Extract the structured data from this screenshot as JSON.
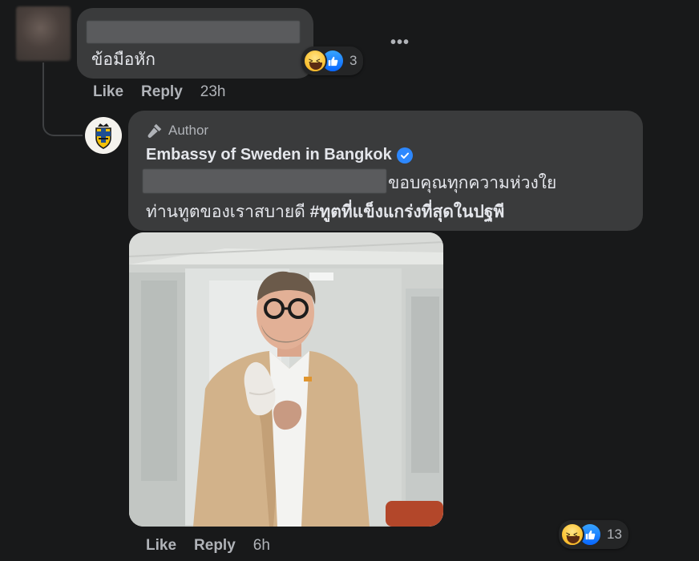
{
  "reply_comment": {
    "text": "ข้อมือหัก",
    "reaction_count": "3",
    "actions": {
      "like": "Like",
      "reply": "Reply",
      "time": "23h"
    },
    "more": "•••"
  },
  "author_reply": {
    "author_badge": "Author",
    "name": "Embassy of Sweden in Bangkok",
    "line1": "ขอบคุณทุกความห่วงใย",
    "line2_plain": "ท่านทูตของเราสบายดี ",
    "hashtag": "#ทูตที่แข็งแกร่งที่สุดในปฐพี",
    "reaction_count": "13",
    "actions": {
      "like": "Like",
      "reply": "Reply",
      "time": "6h"
    }
  },
  "icons": {
    "reactions": [
      "haha-reaction-icon",
      "like-reaction-icon"
    ],
    "author": "microphone-icon",
    "verified": "verified-badge-icon"
  },
  "colors": {
    "background": "#18191a",
    "bubble": "#3a3b3c",
    "text_primary": "#e4e6eb",
    "text_secondary": "#b0b3b8",
    "verified_blue": "#2d88ff",
    "like_blue": "#0866ff"
  }
}
